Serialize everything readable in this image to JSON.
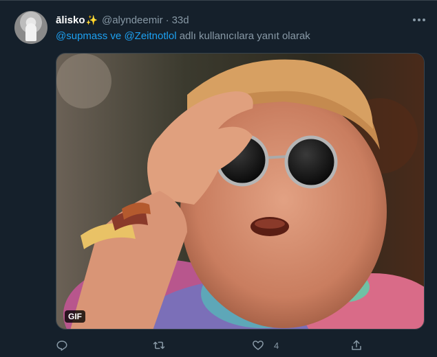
{
  "tweet": {
    "display_name": "ālisko",
    "sparkle_icon": "✨",
    "handle": "@alyndeemir",
    "separator": "·",
    "time": "33d",
    "reply_to": {
      "user1": "@supmass",
      "conjunction": "ve",
      "user2": "@Zeitnotlol",
      "suffix": "adlı kullanıcılara yanıt olarak"
    },
    "media": {
      "gif_badge": "GIF"
    },
    "actions": {
      "like_count": "4"
    }
  },
  "colors": {
    "background": "#15202b",
    "accent": "#1da1f2",
    "muted": "#8899a6"
  }
}
